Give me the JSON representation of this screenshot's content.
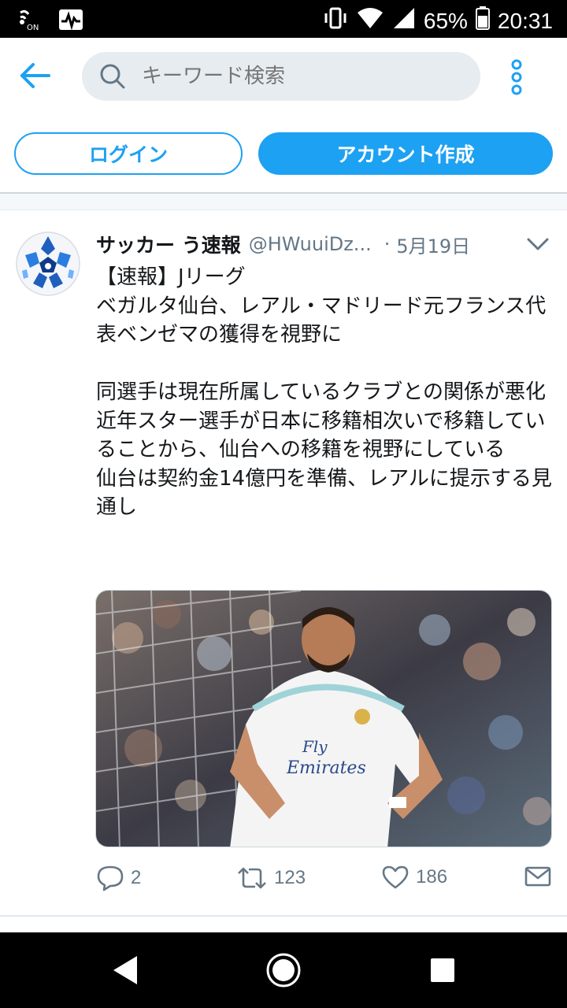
{
  "status_bar": {
    "battery": "65%",
    "time": "20:31",
    "nfc_label": "ON"
  },
  "search": {
    "placeholder": "キーワード検索"
  },
  "auth": {
    "login_label": "ログイン",
    "signup_label": "アカウント作成"
  },
  "tweet": {
    "name": "サッカー う速報",
    "handle": "@HWuuiDz...",
    "separator": "·",
    "date": "5月19日",
    "text": "【速報】Jリーグ\nベガルタ仙台、レアル・マドリード元フランス代表ベンゼマの獲得を視野に\n\n同選手は現在所属しているクラブとの関係が悪化\n近年スター選手が日本に移籍相次いで移籍していることから、仙台への移籍を視野にしている\n仙台は契約金14億円を準備、レアルに提示する見通し",
    "replies": "2",
    "retweets": "123",
    "likes": "186"
  },
  "colors": {
    "accent": "#1da1f2",
    "muted": "#657786"
  }
}
